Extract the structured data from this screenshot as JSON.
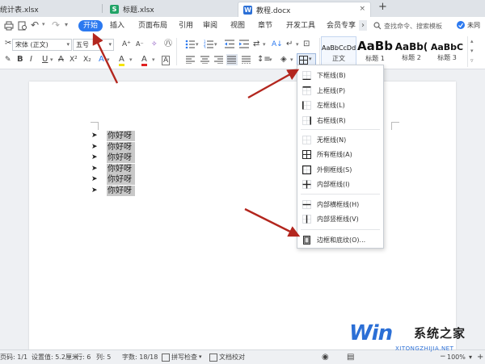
{
  "tabs": [
    {
      "name": "统计表.xlsx",
      "badge": "S"
    },
    {
      "name": "标题.xlsx",
      "badge": "S"
    },
    {
      "name": "教程.docx",
      "badge": "W"
    }
  ],
  "new_tab": "+",
  "menu": {
    "items": [
      "开始",
      "插入",
      "页面布局",
      "引用",
      "审阅",
      "视图",
      "章节",
      "开发工具",
      "会员专享"
    ],
    "more": "›",
    "search_placeholder": "查找命令、搜索模板",
    "share": "未同"
  },
  "toolbar": {
    "font_name": "宋体 (正文)",
    "font_size": "五号",
    "grow_font": "A⁺",
    "shrink_font": "A⁻",
    "bold": "B",
    "italic": "I",
    "underline": "U",
    "strike": "A",
    "superscript": "X²",
    "subscript": "X₂",
    "font_color": "A",
    "highlight": "A",
    "char_border": "A",
    "styles": [
      {
        "preview": "AaBbCcDd",
        "label": "正文"
      },
      {
        "preview": "AaBb",
        "label": "标题 1"
      },
      {
        "preview": "AaBb(",
        "label": "标题 2"
      },
      {
        "preview": "AaBbC",
        "label": "标题 3"
      }
    ]
  },
  "document": {
    "bullet": "➤",
    "lines": [
      "你好呀",
      "你好呀",
      "你好呀",
      "你好呀",
      "你好呀",
      "你好呀"
    ]
  },
  "border_menu": {
    "items": [
      {
        "label": "下框线(B)",
        "icon": "border-bottom-icon"
      },
      {
        "label": "上框线(P)",
        "icon": "border-top-icon"
      },
      {
        "label": "左框线(L)",
        "icon": "border-left-icon"
      },
      {
        "label": "右框线(R)",
        "icon": "border-right-icon"
      },
      {
        "label": "无框线(N)",
        "icon": "border-none-icon"
      },
      {
        "label": "所有框线(A)",
        "icon": "border-all-icon"
      },
      {
        "label": "外侧框线(S)",
        "icon": "border-outside-icon"
      },
      {
        "label": "内部框线(I)",
        "icon": "border-inside-icon"
      },
      {
        "label": "内部横框线(H)",
        "icon": "border-inside-horizontal-icon"
      },
      {
        "label": "内部竖框线(V)",
        "icon": "border-inside-vertical-icon"
      },
      {
        "label": "边框和底纹(O)...",
        "icon": "borders-shading-icon"
      }
    ]
  },
  "status": {
    "page": "页码: 1/1",
    "setting": "设置值: 5.2厘米",
    "row": "行: 6",
    "col": "列: 5",
    "words": "字数: 18/18",
    "spell": "拼写检查",
    "doc_check": "文档校对",
    "zoom": "100%"
  },
  "watermark": {
    "brand": "系统之家",
    "logo": "Win",
    "url": "XITONGZHIJIA.NET"
  },
  "colors": {
    "accent": "#2b79f0",
    "annotation_arrow": "#b3261e",
    "highlight": "#c8c8c8",
    "wps_red": "#d9534f",
    "sheet_green": "#21a366",
    "doc_blue": "#2b6fd6"
  }
}
